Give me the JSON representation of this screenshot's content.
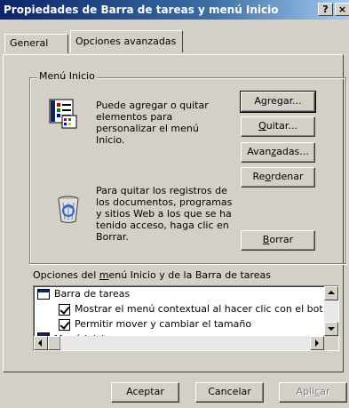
{
  "window": {
    "title": "Propiedades de Barra de tareas y menú Inicio",
    "help_glyph": "?",
    "close_glyph": "×"
  },
  "tabs": [
    {
      "label": "General",
      "selected": false
    },
    {
      "label": "Opciones avanzadas",
      "selected": true
    }
  ],
  "start_menu_group": {
    "legend": "Menú Inicio",
    "customize_text": [
      "Puede agregar o quitar",
      "elementos para",
      "personalizar el menú",
      "Inicio."
    ],
    "clear_text": [
      "Para quitar los registros de",
      "los documentos, programas",
      "y sitios Web a los que se ha",
      "tenido acceso, haga clic en",
      "Borrar."
    ],
    "buttons": {
      "add_pre": "A",
      "add_u": "g",
      "add_post": "regar...",
      "remove_pre": "",
      "remove_u": "Q",
      "remove_post": "uitar...",
      "advanced_pre": "Avan",
      "advanced_u": "z",
      "advanced_post": "adas...",
      "sort_pre": "Re",
      "sort_u": "o",
      "sort_post": "rdenar",
      "clear_pre": "",
      "clear_u": "B",
      "clear_post": "orrar"
    }
  },
  "options": {
    "label_pre": "Opciones del ",
    "label_u": "m",
    "label_post": "enú Inicio y de la Barra de tareas",
    "items": [
      {
        "label": "Barra de tareas",
        "type": "folder"
      },
      {
        "label": "Mostrar el menú contextual al hacer clic con el bot",
        "type": "checkbox",
        "checked": true
      },
      {
        "label": "Permitir mover y cambiar el tamaño",
        "type": "checkbox",
        "checked": true
      },
      {
        "label": "Menú Inicio",
        "type": "folder"
      }
    ]
  },
  "footer": {
    "ok": "Aceptar",
    "cancel": "Cancelar",
    "apply_pre": "Apli",
    "apply_u": "c",
    "apply_post": "ar"
  },
  "colors": {
    "title_start": "#0a246a",
    "title_end": "#a6caf0",
    "face": "#d4d0c8"
  }
}
